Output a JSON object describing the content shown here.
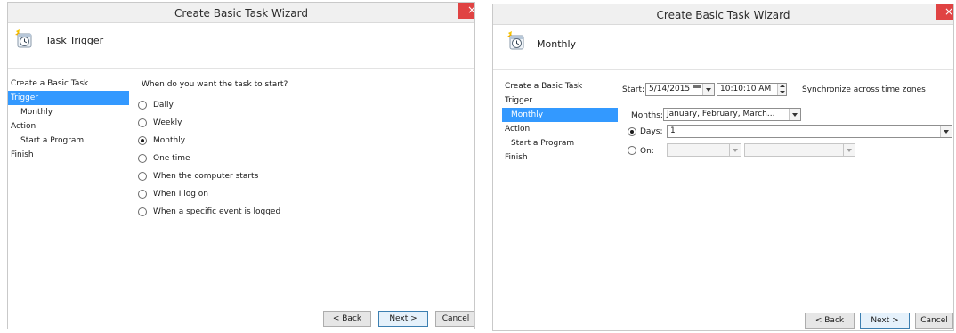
{
  "colors": {
    "selection": "#3399ff",
    "close": "#e04343"
  },
  "icons": {
    "header": "task-scheduler-clock-icon",
    "close": "close-icon"
  },
  "left_window": {
    "title": "Create Basic Task Wizard",
    "close_glyph": "×",
    "header_title": "Task Trigger",
    "steps": [
      {
        "label": "Create a Basic Task"
      },
      {
        "label": "Trigger",
        "selected": true
      },
      {
        "label": "Monthly"
      },
      {
        "label": "Action"
      },
      {
        "label": "Start a Program"
      },
      {
        "label": "Finish"
      }
    ],
    "question": "When do you want the task to start?",
    "options": [
      {
        "label": "Daily",
        "checked": false
      },
      {
        "label": "Weekly",
        "checked": false
      },
      {
        "label": "Monthly",
        "checked": true
      },
      {
        "label": "One time",
        "checked": false
      },
      {
        "label": "When the computer starts",
        "checked": false
      },
      {
        "label": "When I log on",
        "checked": false
      },
      {
        "label": "When a specific event is logged",
        "checked": false
      }
    ],
    "buttons": {
      "back": "< Back",
      "next": "Next >",
      "cancel": "Cancel"
    }
  },
  "right_window": {
    "title": "Create Basic Task Wizard",
    "close_glyph": "×",
    "header_title": "Monthly",
    "steps": [
      {
        "label": "Create a Basic Task"
      },
      {
        "label": "Trigger"
      },
      {
        "label": "Monthly",
        "selected": true
      },
      {
        "label": "Action"
      },
      {
        "label": "Start a Program"
      },
      {
        "label": "Finish"
      }
    ],
    "start_label": "Start:",
    "start_date": "5/14/2015",
    "start_time": "10:10:10 AM",
    "sync_label": "Synchronize across time zones",
    "sync_checked": false,
    "months_label": "Months:",
    "months_value": "January, February, March...",
    "days_label": "Days:",
    "days_value": "1",
    "days_checked": true,
    "on_label": "On:",
    "on_checked": false,
    "buttons": {
      "back": "< Back",
      "next": "Next >",
      "cancel": "Cancel"
    }
  }
}
